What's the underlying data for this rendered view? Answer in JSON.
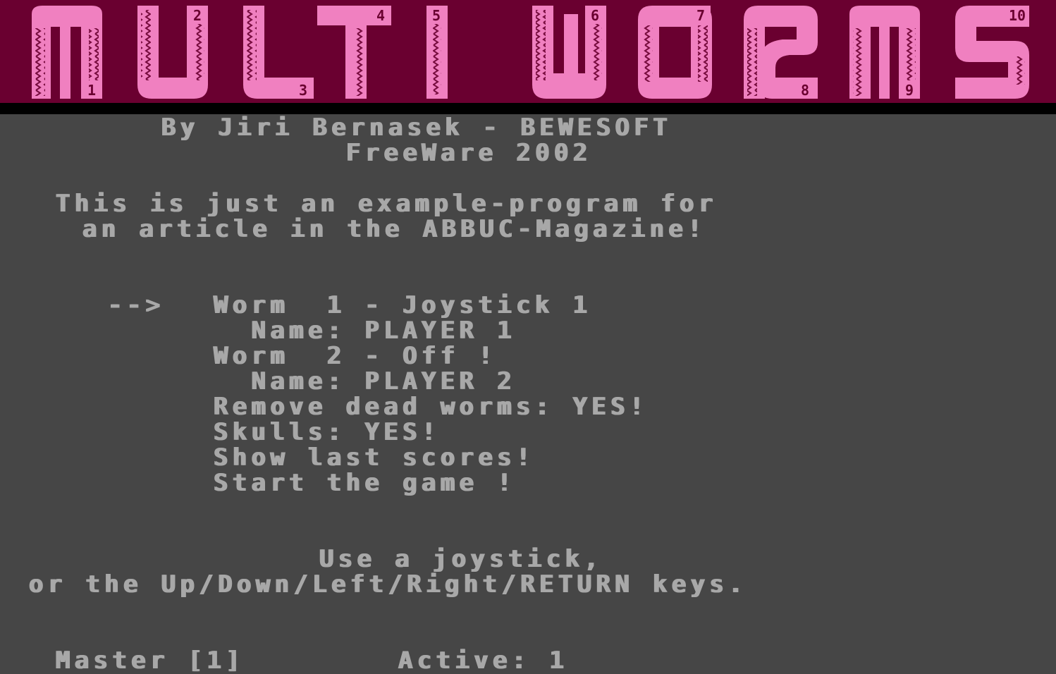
{
  "title_banner": {
    "text": "MULTI WORMS",
    "worm_numbers": [
      "1",
      "2",
      "3",
      "4",
      "5",
      "6",
      "7",
      "8",
      "9",
      "10"
    ],
    "colors": {
      "background": "#6a0030",
      "worm": "#f080c0",
      "pattern": "#6a0030"
    }
  },
  "credits": {
    "author": "By Jiri Bernasek - BEWESOFT",
    "license": "FreeWare 2002"
  },
  "intro": {
    "line1": "This is just an example-program for",
    "line2": "an article in the ABBUC-Magazine!"
  },
  "menu": {
    "cursor": "-->",
    "items": [
      {
        "label": "Worm  1 - Joystick 1"
      },
      {
        "label": "  Name: PLAYER 1"
      },
      {
        "label": "Worm  2 - Off !"
      },
      {
        "label": "  Name: PLAYER 2"
      },
      {
        "label": "Remove dead worms: YES!"
      },
      {
        "label": "Skulls: YES!"
      },
      {
        "label": "Show last scores!"
      },
      {
        "label": "Start the game !"
      }
    ]
  },
  "help": {
    "line1": "Use a joystick,",
    "line2": "or the Up/Down/Left/Right/RETURN keys."
  },
  "status": {
    "master": "Master [1]",
    "active": "Active: 1"
  },
  "colors": {
    "screen_background": "#464646",
    "text": "#a8a8a8",
    "divider": "#000000"
  }
}
